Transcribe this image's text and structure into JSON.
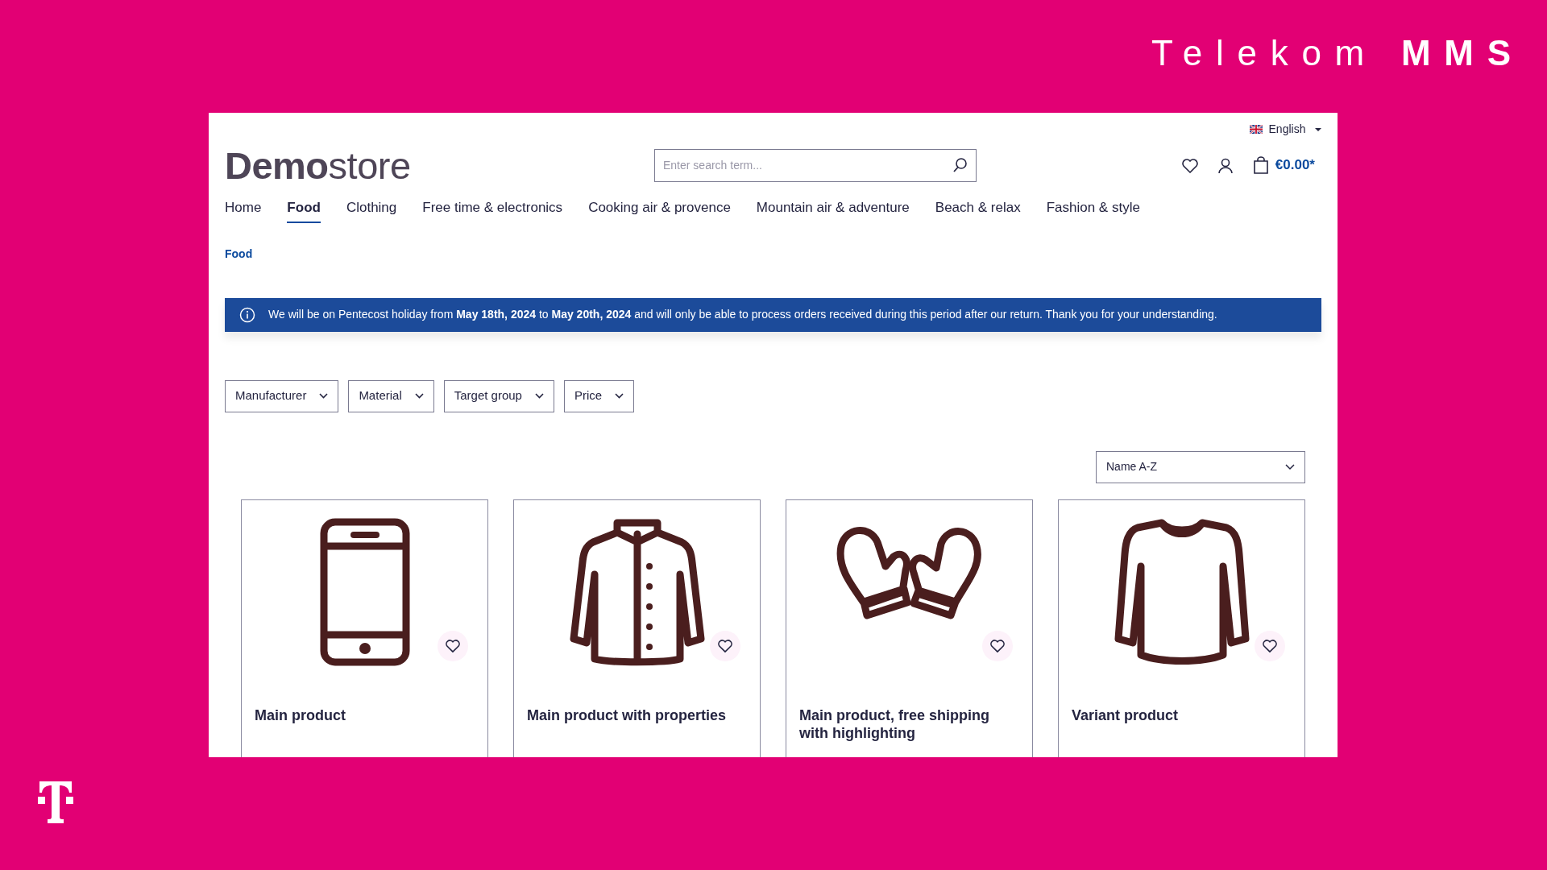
{
  "brand": {
    "text": "Telekom **MMS**"
  },
  "store": {
    "language": "English",
    "logo": "**Demo**store",
    "search": {
      "placeholder": "Enter search term..."
    },
    "cart_total": "€0.00*"
  },
  "nav": [
    {
      "label": "Home",
      "selected": false
    },
    {
      "label": "Food",
      "selected": true
    },
    {
      "label": "Clothing",
      "selected": false
    },
    {
      "label": "Free time & electronics",
      "selected": false
    },
    {
      "label": "Cooking air & provence",
      "selected": false
    },
    {
      "label": "Mountain air & adventure",
      "selected": false
    },
    {
      "label": "Beach & relax",
      "selected": false
    },
    {
      "label": "Fashion & style",
      "selected": false
    }
  ],
  "breadcrumb": [
    "Food"
  ],
  "notice": "We will be on Pentecost holiday from **May 18th, 2024** to **May 20th, 2024** and will only be able to process orders received during this period after our return. Thank you for your understanding.",
  "filters": [
    "Manufacturer",
    "Material",
    "Target group",
    "Price"
  ],
  "sort": {
    "value": "Name A-Z"
  },
  "products": [
    {
      "name": "Main product",
      "kind": "phone"
    },
    {
      "name": "Main product with properties",
      "kind": "jacket"
    },
    {
      "name": "Main product, free shipping with highlighting",
      "kind": "mittens"
    },
    {
      "name": "Variant product",
      "kind": "sweater"
    }
  ]
}
